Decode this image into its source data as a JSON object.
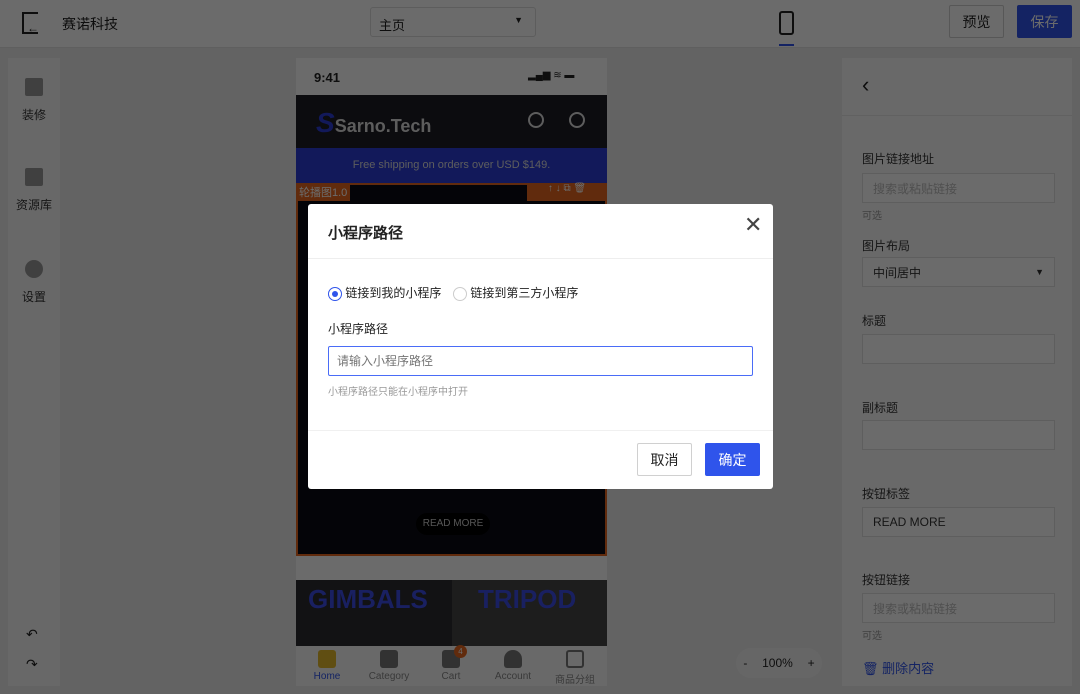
{
  "topbar": {
    "brand": "赛诺科技",
    "page_select": "主页",
    "preview": "预览",
    "save": "保存"
  },
  "sidebar": {
    "items": [
      {
        "label": "装修",
        "icon": "brush-icon"
      },
      {
        "label": "资源库",
        "icon": "layout-icon"
      },
      {
        "label": "设置",
        "icon": "gear-icon"
      }
    ]
  },
  "phone": {
    "time": "9:41",
    "logo": "Sarno.Tech",
    "shipping": "Free shipping on orders over USD $149.",
    "component_label": "轮播图1.0",
    "read_more": "READ MORE",
    "tiles": [
      "GIMBALS",
      "TRIPOD"
    ],
    "tabs": [
      {
        "label": "Home",
        "icon": "home-pikachu-icon"
      },
      {
        "label": "Category",
        "icon": "category-icon"
      },
      {
        "label": "Cart",
        "icon": "cart-icon",
        "badge": "4"
      },
      {
        "label": "Account",
        "icon": "account-icon"
      },
      {
        "label": "商品分组",
        "icon": "bookmark-icon"
      }
    ]
  },
  "zoom": {
    "minus": "-",
    "value": "100%",
    "plus": "+"
  },
  "panel": {
    "img_link_label": "图片链接地址",
    "img_link_placeholder": "搜索或粘贴链接",
    "optional": "可选",
    "layout_label": "图片布局",
    "layout_value": "中间居中",
    "title_label": "标题",
    "subtitle_label": "副标题",
    "btn_label_label": "按钮标签",
    "btn_label_value": "READ MORE",
    "btn_link_label": "按钮链接",
    "btn_link_placeholder": "搜索或粘贴链接",
    "optional2": "可选",
    "delete": "删除内容"
  },
  "dialog": {
    "title": "小程序路径",
    "radio1": "链接到我的小程序",
    "radio2": "链接到第三方小程序",
    "selected": "radio1",
    "field_label": "小程序路径",
    "placeholder": "请输入小程序路径",
    "help": "小程序路径只能在小程序中打开",
    "cancel": "取消",
    "confirm": "确定"
  },
  "colors": {
    "accent": "#2f54eb",
    "orange": "#e8671e",
    "brand_blue": "#2b3bd6"
  }
}
